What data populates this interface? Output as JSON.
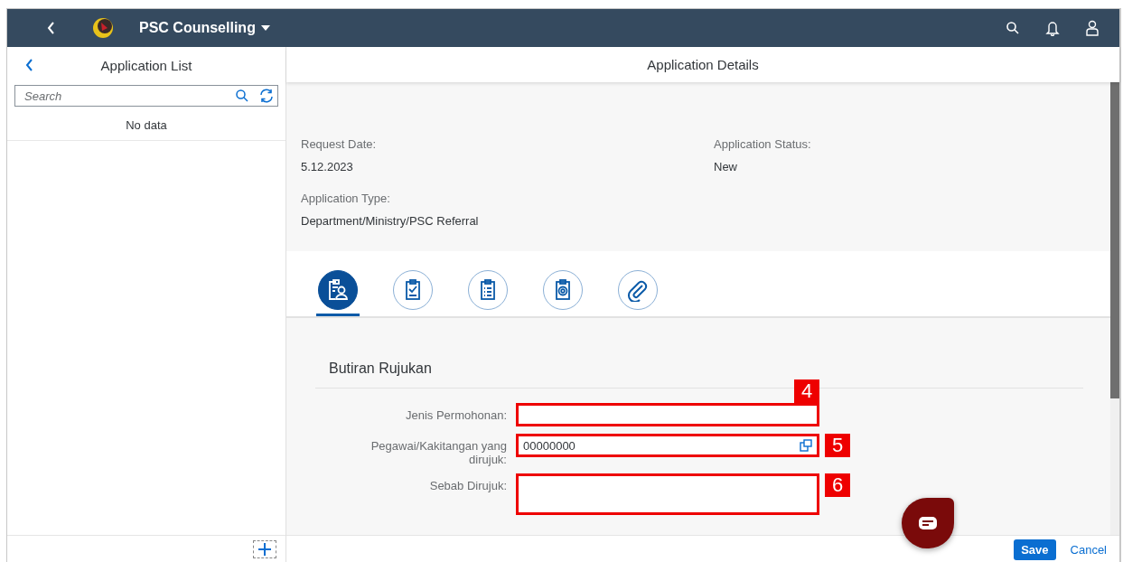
{
  "shell": {
    "title": "PSC Counselling"
  },
  "list_panel": {
    "title": "Application List",
    "search": {
      "placeholder": "Search"
    },
    "empty_text": "No data"
  },
  "details": {
    "title": "Application Details",
    "header_fields": [
      {
        "label": "Request Date:",
        "value": "5.12.2023"
      },
      {
        "label": "Application Status:",
        "value": "New"
      },
      {
        "label": "Application Type:",
        "value": "Department/Ministry/PSC Referral"
      }
    ],
    "tabs": [
      {
        "kind": "person",
        "selected": true
      },
      {
        "kind": "check",
        "selected": false
      },
      {
        "kind": "list",
        "selected": false
      },
      {
        "kind": "target",
        "selected": false
      },
      {
        "kind": "attachment",
        "selected": false
      }
    ],
    "section_title": "Butiran Rujukan",
    "form": [
      {
        "kind": "input",
        "label": "Jenis Permohonan:",
        "callout": "4"
      },
      {
        "kind": "value-help",
        "label": "Pegawai/Kakitangan yang dirujuk:",
        "value": "00000000",
        "callout": "5"
      },
      {
        "kind": "textarea",
        "label": "Sebab Dirujuk:",
        "callout": "6"
      }
    ]
  },
  "footer": {
    "buttons": [
      {
        "label": "Save",
        "kind": "primary"
      },
      {
        "label": "Cancel",
        "kind": "transparent"
      }
    ]
  }
}
